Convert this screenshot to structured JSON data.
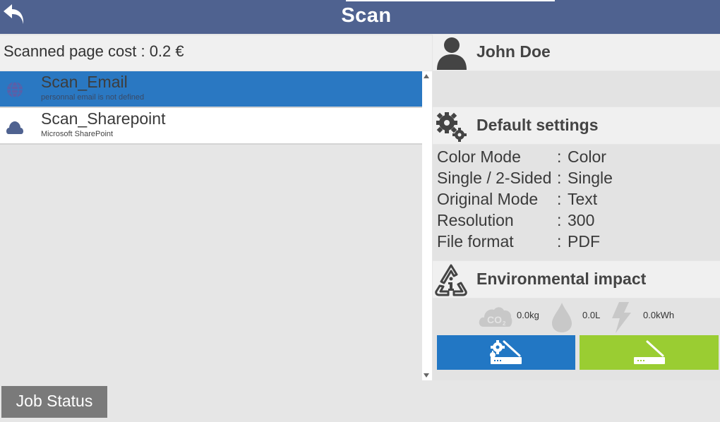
{
  "header": {
    "title": "Scan",
    "back_icon": "back-arrow-icon",
    "bar_color": "#4f6290"
  },
  "cost": {
    "text": "Scanned page cost : 0.2 €"
  },
  "workflows": [
    {
      "name": "Scan_Email",
      "description": "personnal email is not defined",
      "icon": "globe-icon",
      "selected": true
    },
    {
      "name": "Scan_Sharepoint",
      "description": "Microsoft SharePoint",
      "icon": "cloud-icon",
      "selected": false
    }
  ],
  "user": {
    "name": "John Doe",
    "icon": "user-icon"
  },
  "settings": {
    "title": "Default settings",
    "icon": "gears-icon",
    "rows": [
      {
        "label": "Color Mode",
        "value": "Color"
      },
      {
        "label": "Single / 2-Sided",
        "value": "Single"
      },
      {
        "label": "Original Mode",
        "value": "Text"
      },
      {
        "label": "Resolution",
        "value": "300"
      },
      {
        "label": "File format",
        "value": "PDF"
      }
    ],
    "colon": ":"
  },
  "environment": {
    "title": "Environmental impact",
    "icon": "recycle-info-icon",
    "co2": "0.0kg",
    "water": "0.0L",
    "energy": "0.0kWh"
  },
  "actions": {
    "settings_button_icon": "scanner-settings-icon",
    "start_button_icon": "scanner-start-icon",
    "settings_color": "#2277c4",
    "start_color": "#9acd32"
  },
  "footer": {
    "job_status_label": "Job Status"
  }
}
